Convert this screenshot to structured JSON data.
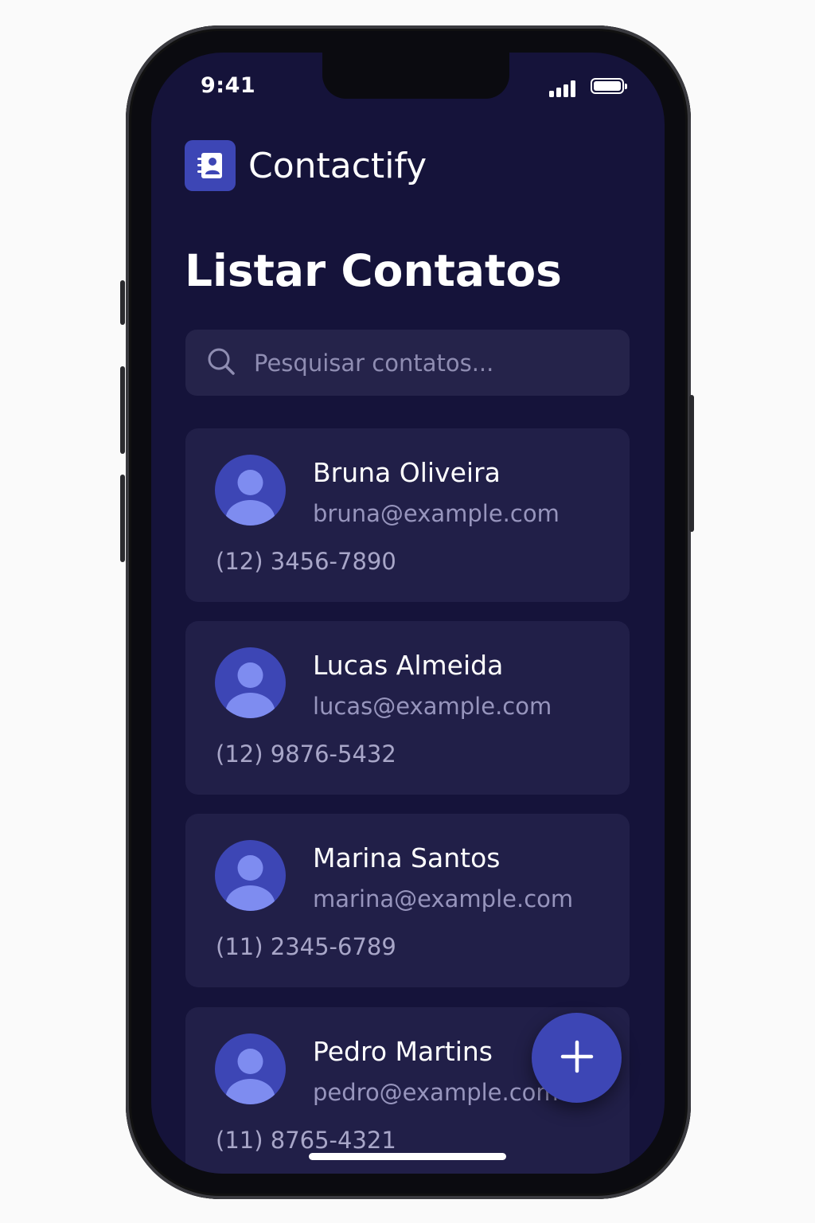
{
  "status_bar": {
    "time": "9:41",
    "signal_icon": "signal-bars-icon",
    "battery_icon": "battery-full-icon"
  },
  "app": {
    "name": "Contactify",
    "logo_icon": "contact-book-icon"
  },
  "page": {
    "title": "Listar Contatos"
  },
  "search": {
    "placeholder": "Pesquisar contatos...",
    "value": "",
    "icon": "search-icon"
  },
  "contacts": [
    {
      "name": "Bruna Oliveira",
      "email": "bruna@example.com",
      "phone": "(12) 3456-7890"
    },
    {
      "name": "Lucas Almeida",
      "email": "lucas@example.com",
      "phone": "(12) 9876-5432"
    },
    {
      "name": "Marina Santos",
      "email": "marina@example.com",
      "phone": "(11) 2345-6789"
    },
    {
      "name": "Pedro Martins",
      "email": "pedro@example.com",
      "phone": "(11) 8765-4321"
    }
  ],
  "fab": {
    "icon": "plus-icon"
  },
  "colors": {
    "background": "#15133a",
    "card": "#211f48",
    "accent": "#3d46b5",
    "avatar_figure": "#7e8cf0",
    "secondary_text": "#9795bd"
  }
}
